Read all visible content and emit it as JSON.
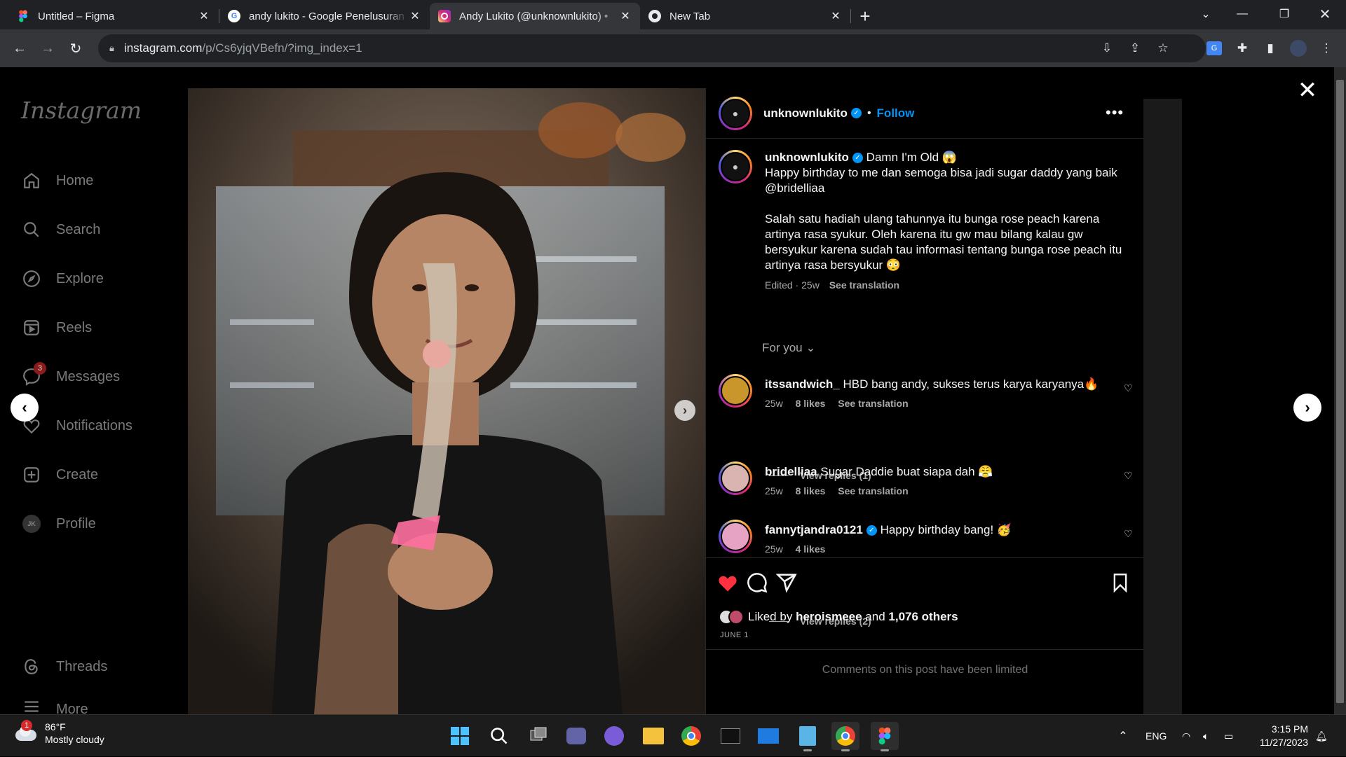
{
  "browser": {
    "tabs": [
      {
        "title": "Untitled – Figma",
        "favicon": "figma-icon",
        "active": false
      },
      {
        "title": "andy lukito - Google Penelusuran",
        "favicon": "google-icon",
        "active": false
      },
      {
        "title": "Andy Lukito (@unknownlukito) •",
        "favicon": "instagram-icon",
        "active": true
      },
      {
        "title": "New Tab",
        "favicon": "chrome-icon",
        "active": false
      }
    ],
    "url_host": "instagram.com",
    "url_path": "/p/Cs6yjqVBefn/?img_index=1"
  },
  "sidebar": {
    "logo": "Instagram",
    "items": [
      {
        "label": "Home",
        "icon": "home-icon"
      },
      {
        "label": "Search",
        "icon": "search-icon"
      },
      {
        "label": "Explore",
        "icon": "compass-icon"
      },
      {
        "label": "Reels",
        "icon": "reels-icon"
      },
      {
        "label": "Messages",
        "icon": "messenger-icon",
        "badge": "3"
      },
      {
        "label": "Notifications",
        "icon": "heart-icon"
      },
      {
        "label": "Create",
        "icon": "plus-square-icon"
      },
      {
        "label": "Profile",
        "icon": "profile-avatar",
        "avatar_text": "JK"
      },
      {
        "label": "Threads",
        "icon": "threads-icon"
      },
      {
        "label": "More",
        "icon": "menu-icon"
      }
    ]
  },
  "post": {
    "username": "unknownlukito",
    "follow_label": "Follow",
    "caption_title": "Damn I'm Old 😱",
    "caption_p1": "Happy birthday to me dan semoga bisa jadi sugar daddy yang baik @bridelliaa",
    "caption_p2": "Salah satu hadiah ulang tahunnya itu bunga rose peach karena artinya rasa syukur. Oleh karena itu gw mau bilang kalau gw bersyukur karena sudah tau informasi tentang bunga rose peach itu artinya rasa bersyukur 😳",
    "caption_meta_edited": "Edited · 25w",
    "see_translation": "See translation",
    "for_you": "For you",
    "comments": [
      {
        "user": "itssandwich_",
        "verified": false,
        "text": "HBD bang andy, sukses terus karya karyanya🔥",
        "time": "25w",
        "likes": "8 likes",
        "translation": "See translation",
        "replies": "View replies (1)"
      },
      {
        "user": "bridelliaa",
        "verified": false,
        "text": "Sugar Daddie buat siapa dah 😤",
        "time": "25w",
        "likes": "8 likes",
        "translation": "See translation",
        "replies": ""
      },
      {
        "user": "fannytjandra0121",
        "verified": true,
        "text": "Happy birthday bang! 🥳",
        "time": "25w",
        "likes": "4 likes",
        "translation": "",
        "replies": "View replies (2)"
      }
    ],
    "liked_by_prefix": "Liked by",
    "liked_by_user": "heroismeee",
    "liked_by_and": "and",
    "liked_by_others": "1,076 others",
    "date": "JUNE 1",
    "comments_limited": "Comments on this post have been limited"
  },
  "taskbar": {
    "weather_temp": "86°F",
    "weather_desc": "Mostly cloudy",
    "weather_badge": "1",
    "language": "ENG",
    "time": "3:15 PM",
    "date": "11/27/2023"
  },
  "colors": {
    "accent_blue": "#0095f6",
    "like_red": "#ff3040",
    "chrome_bg": "#202124"
  }
}
